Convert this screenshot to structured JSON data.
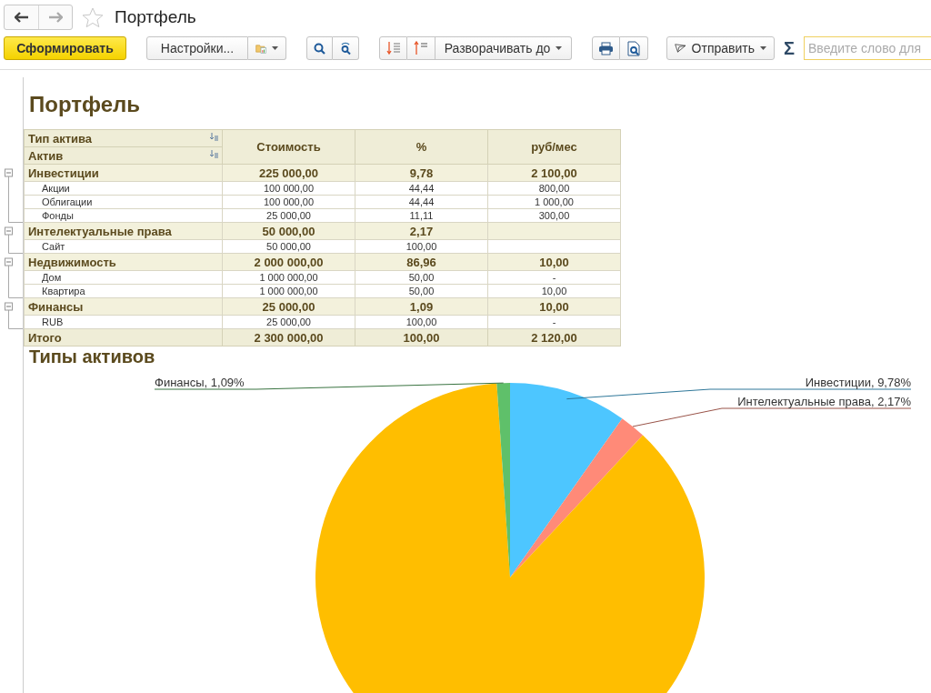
{
  "window": {
    "title": "Портфель",
    "favorite": false,
    "back_enabled": true,
    "forward_enabled": false
  },
  "toolbar": {
    "generate": "Сформировать",
    "settings": "Настройки...",
    "expand_to": "Разворачивать до",
    "send": "Отправить",
    "sum": "Σ",
    "search": {
      "placeholder": "Введите слово для"
    }
  },
  "report": {
    "title": "Портфель",
    "table": {
      "columns": [
        "Тип актива",
        "Актив",
        "Стоимость",
        "%",
        "руб/мес"
      ],
      "rows": [
        {
          "label": "Инвестиции",
          "expanded": true,
          "cost": "225 000,00",
          "percent": "9,78",
          "per_month": "2 100,00",
          "children": [
            {
              "label": "Акции",
              "cost": "100 000,00",
              "percent": "44,44",
              "per_month": "800,00"
            },
            {
              "label": "Облигации",
              "cost": "100 000,00",
              "percent": "44,44",
              "per_month": "1 000,00"
            },
            {
              "label": "Фонды",
              "cost": "25 000,00",
              "percent": "11,11",
              "per_month": "300,00"
            }
          ]
        },
        {
          "label": "Интелектуальные права",
          "expanded": true,
          "cost": "50 000,00",
          "percent": "2,17",
          "children": [
            {
              "label": "Сайт",
              "cost": "50 000,00",
              "percent": "100,00"
            }
          ]
        },
        {
          "label": "Недвижимость",
          "expanded": true,
          "cost": "2 000 000,00",
          "percent": "86,96",
          "per_month": "10,00",
          "children": [
            {
              "label": "Дом",
              "cost": "1 000 000,00",
              "percent": "50,00",
              "per_month": "-"
            },
            {
              "label": "Квартира",
              "cost": "1 000 000,00",
              "percent": "50,00",
              "per_month": "10,00"
            }
          ]
        },
        {
          "label": "Финансы",
          "expanded": true,
          "cost": "25 000,00",
          "percent": "1,09",
          "per_month": "10,00",
          "children": [
            {
              "label": "RUB",
              "cost": "25 000,00",
              "percent": "100,00",
              "per_month": "-"
            }
          ]
        }
      ],
      "total": {
        "label": "Итого",
        "cost": "2 300 000,00",
        "percent": "100,00",
        "per_month": "2 120,00"
      }
    },
    "chart_title": "Типы активов",
    "chart": {
      "chart_data": {
        "type": "pie",
        "categories": [
          "Инвестиции, 9,78%",
          "Интелектуальные права, 2,17%",
          null,
          "Финансы, 1,09%"
        ],
        "series": [
          {
            "values": [
              9.78,
              2.17,
              86.96,
              1.09
            ]
          }
        ],
        "colors": [
          "#4dc6ff",
          "#ff8a78",
          "#ffbe00",
          "#5fc06a"
        ]
      }
    }
  }
}
